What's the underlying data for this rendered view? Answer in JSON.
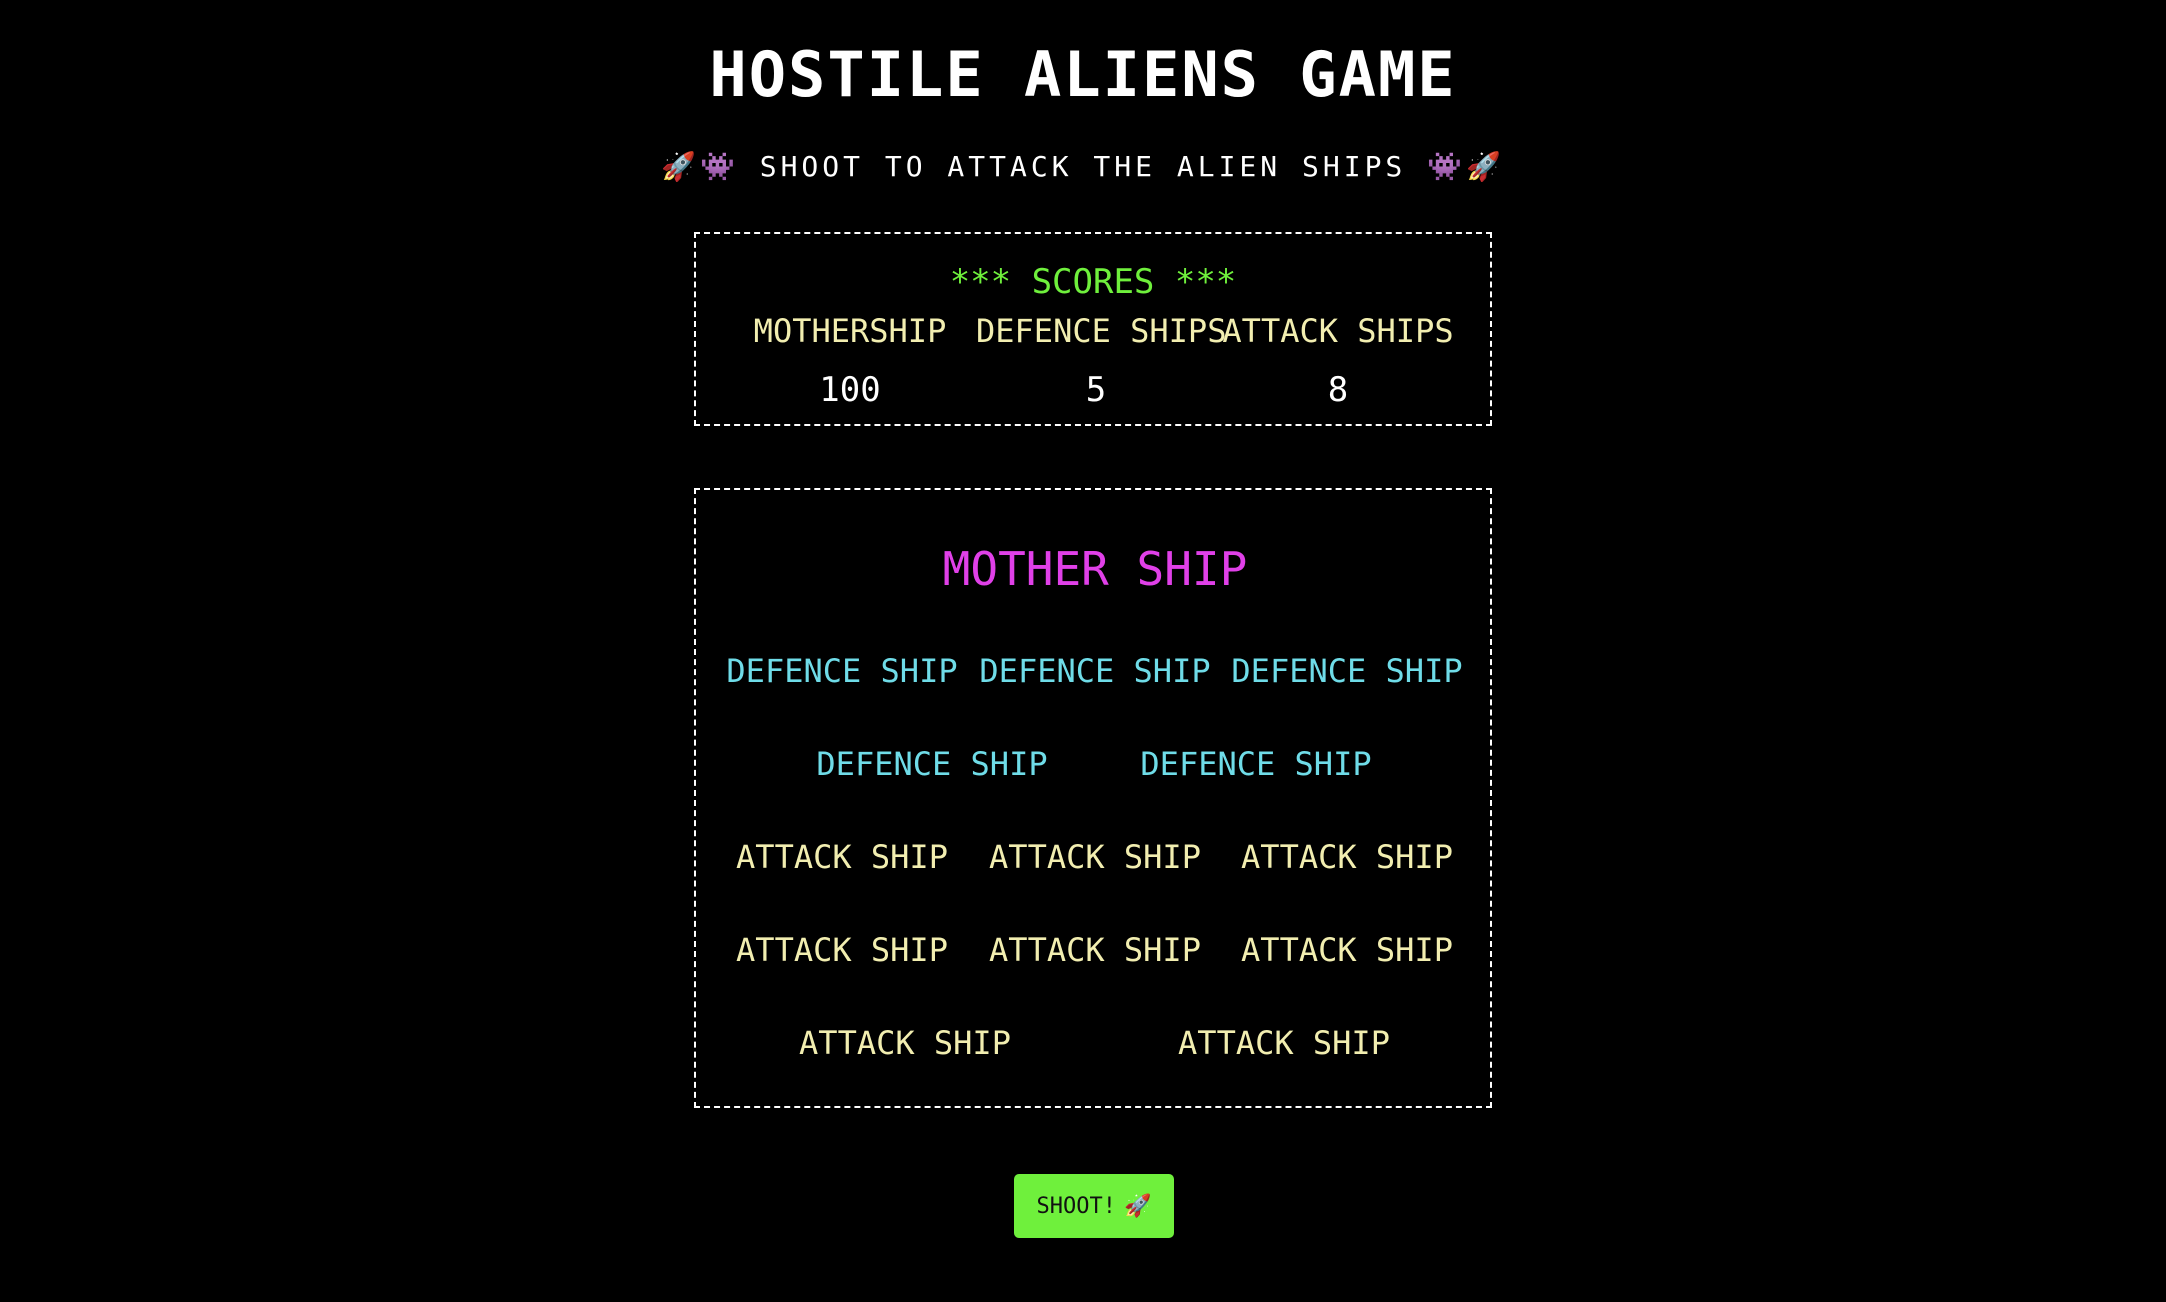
{
  "header": {
    "title": "Hostile Aliens Game",
    "subtitle": "🚀👾 Shoot to attack the alien ships 👾🚀"
  },
  "scores": {
    "heading": "*** Scores ***",
    "mothership_label": "Mothership",
    "mothership_value": "100",
    "defence_label": "Defence Ships",
    "defence_value": "5",
    "attack_label": "Attack Ships",
    "attack_value": "8"
  },
  "fleet": {
    "mother_ship": "Mother Ship",
    "defence_ships": [
      "Defence Ship",
      "Defence Ship",
      "Defence Ship",
      "Defence Ship",
      "Defence Ship"
    ],
    "attack_ships": [
      "Attack Ship",
      "Attack Ship",
      "Attack Ship",
      "Attack Ship",
      "Attack Ship",
      "Attack Ship",
      "Attack Ship",
      "Attack Ship"
    ]
  },
  "controls": {
    "shoot_label": "Shoot!",
    "shoot_icon": "🚀"
  },
  "colors": {
    "background": "#000000",
    "scores_heading": "#6ff03c",
    "mother_ship": "#e040e8",
    "defence_ship": "#6fdce8",
    "attack_ship": "#f2eeb0",
    "button": "#6ff03c"
  }
}
